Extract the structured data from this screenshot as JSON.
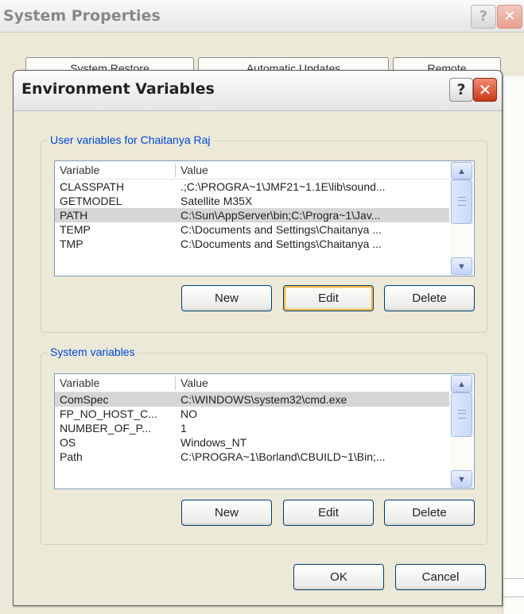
{
  "background_window": {
    "title": "System Properties",
    "help_label": "?",
    "close_label": "✕",
    "tabs": [
      "System Restore",
      "Automatic Updates",
      "Remote"
    ]
  },
  "dialog": {
    "title": "Environment Variables",
    "help_label": "?",
    "close_label": "✕",
    "ok_label": "OK",
    "cancel_label": "Cancel"
  },
  "user_vars": {
    "legend": "User variables for Chaitanya Raj",
    "columns": [
      "Variable",
      "Value"
    ],
    "rows": [
      {
        "variable": "CLASSPATH",
        "value": ".;C:\\PROGRA~1\\JMF21~1.1E\\lib\\sound..."
      },
      {
        "variable": "GETMODEL",
        "value": "Satellite M35X"
      },
      {
        "variable": "PATH",
        "value": "C:\\Sun\\AppServer\\bin;C:\\Progra~1\\Jav..."
      },
      {
        "variable": "TEMP",
        "value": "C:\\Documents and Settings\\Chaitanya ..."
      },
      {
        "variable": "TMP",
        "value": "C:\\Documents and Settings\\Chaitanya ..."
      }
    ],
    "selected_row": 2,
    "new_label": "New",
    "edit_label": "Edit",
    "delete_label": "Delete"
  },
  "system_vars": {
    "legend": "System variables",
    "columns": [
      "Variable",
      "Value"
    ],
    "rows": [
      {
        "variable": "ComSpec",
        "value": "C:\\WINDOWS\\system32\\cmd.exe"
      },
      {
        "variable": "FP_NO_HOST_C...",
        "value": "NO"
      },
      {
        "variable": "NUMBER_OF_P...",
        "value": "1"
      },
      {
        "variable": "OS",
        "value": "Windows_NT"
      },
      {
        "variable": "Path",
        "value": "C:\\PROGRA~1\\Borland\\CBUILD~1\\Bin;..."
      }
    ],
    "selected_row": 0,
    "new_label": "New",
    "edit_label": "Edit",
    "delete_label": "Delete"
  },
  "icons": {
    "scroll_up": "▲",
    "scroll_down": "▼"
  },
  "colors": {
    "dialog_bg": "#ece9d8",
    "legend_text": "#0046d5",
    "close_button": "#c9381a",
    "selected_row": "#d6d6d6",
    "focus_ring": "#f8b94c"
  }
}
